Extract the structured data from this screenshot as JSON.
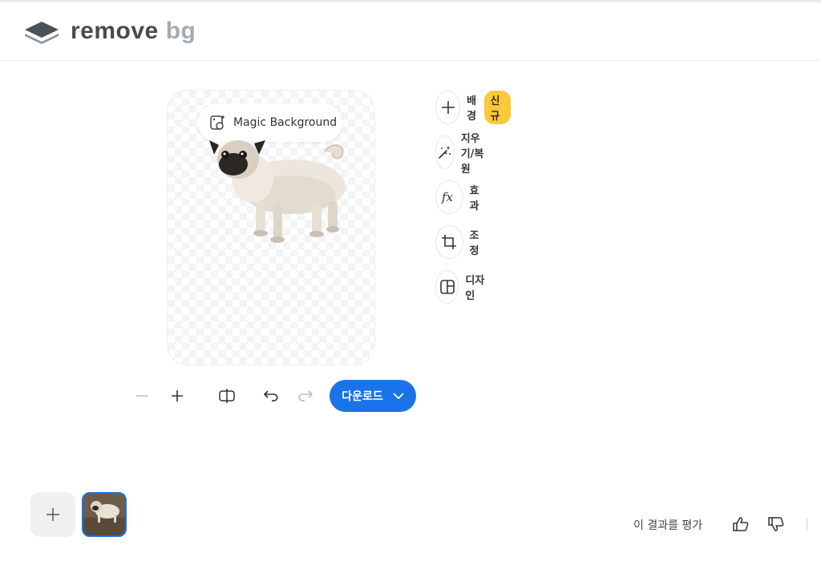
{
  "brand": {
    "word1": "remove",
    "word2": "bg"
  },
  "canvas": {
    "magic_background_label": "Magic Background"
  },
  "tools": [
    {
      "label": "배경",
      "badge": "신규",
      "icon": "plus-icon"
    },
    {
      "label": "지우기/복원",
      "icon": "magic-brush-icon"
    },
    {
      "label": "효과",
      "icon": "fx-icon"
    },
    {
      "label": "조정",
      "icon": "crop-icon"
    },
    {
      "label": "디자인",
      "icon": "layout-icon"
    }
  ],
  "toolbar": {
    "zoom_out_icon": "minus-icon",
    "zoom_in_icon": "plus-icon",
    "compare_icon": "compare-icon",
    "undo_icon": "undo-icon",
    "redo_icon": "redo-icon",
    "download_label": "다운로드"
  },
  "footer": {
    "rate_label": "이 결과를 평가"
  },
  "colors": {
    "accent": "#1a73e8",
    "badge": "#ffc83a"
  }
}
